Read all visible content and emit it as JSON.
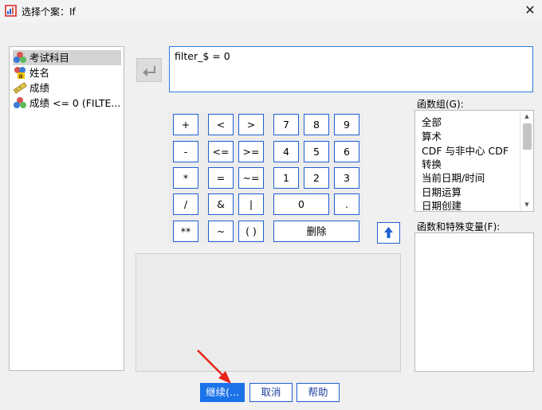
{
  "window": {
    "title": "选择个案：If",
    "close_glyph": "✕"
  },
  "variables": [
    {
      "label": "考试科目",
      "icon": "nominal-variable-icon",
      "selected": true
    },
    {
      "label": "姓名",
      "icon": "string-variable-icon",
      "selected": false
    },
    {
      "label": "成绩",
      "icon": "scale-variable-icon",
      "selected": false
    },
    {
      "label": "成绩 <= 0 (FILTE...",
      "icon": "nominal-variable-icon",
      "selected": false
    }
  ],
  "expression": {
    "value": "filter_$ = 0"
  },
  "keypad": {
    "row1": [
      "+",
      "<",
      ">",
      "7",
      "8",
      "9"
    ],
    "row2": [
      "-",
      "<=",
      ">=",
      "4",
      "5",
      "6"
    ],
    "row3": [
      "*",
      "=",
      "~=",
      "1",
      "2",
      "3"
    ],
    "row4": [
      "/",
      "&",
      "|",
      "0",
      "."
    ],
    "row5": [
      "**",
      "~",
      "( )",
      "删除"
    ]
  },
  "function_group": {
    "label": "函数组(G):",
    "items": [
      "全部",
      "算术",
      "CDF 与非中心 CDF",
      "转换",
      "当前日期/时间",
      "日期运算",
      "日期创建"
    ]
  },
  "functions_vars": {
    "label": "函数和特殊变量(F):"
  },
  "buttons": {
    "continue": "继续(...",
    "cancel": "取消",
    "help": "帮助"
  },
  "colors": {
    "accent": "#1a73e8",
    "key_border": "#1f5fd1",
    "annotation_arrow": "#e8231a"
  }
}
